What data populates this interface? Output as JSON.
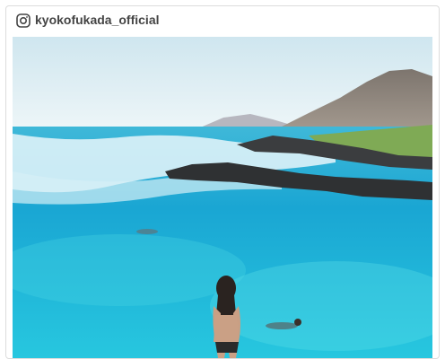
{
  "post": {
    "username": "kyokofukada_official",
    "platform_icon": "instagram-icon",
    "photo_subject": "beach-photo"
  },
  "colors": {
    "sky": "#dcebf2",
    "ocean": "#1fb3d6",
    "lagoon": "#2fd0e0",
    "rock": "#3a3c3e",
    "mountain": "#8a8078",
    "grass": "#7faa55"
  }
}
